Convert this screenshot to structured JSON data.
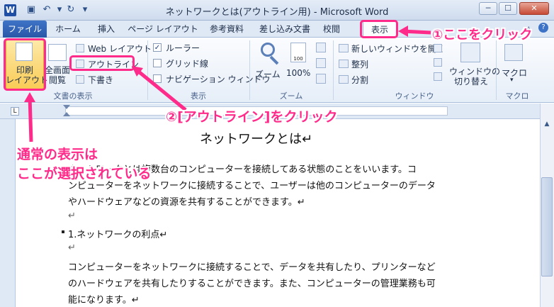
{
  "window": {
    "title": "ネットワークとは(アウトライン用)  -  Microsoft Word",
    "app_icon": "W",
    "buttons": [
      "─",
      "☐",
      "✕"
    ]
  },
  "quick_access": [
    "save-icon",
    "undo-icon",
    "redo-icon",
    "customize-icon"
  ],
  "tabs": [
    "ファイル",
    "ホーム",
    "挿入",
    "ページ レイアウト",
    "参考資料",
    "差し込み文書",
    "校閲",
    "表示"
  ],
  "ribbon": {
    "views": {
      "print_layout": "印刷\nレイアウト",
      "full_screen": "全画面\n閲覧",
      "web_layout": "Web レイアウト",
      "outline": "アウトライン",
      "draft": "下書き",
      "group_label": "文書の表示"
    },
    "show": {
      "ruler": "ルーラー",
      "ruler_checked": true,
      "gridlines": "グリッド線",
      "nav_pane": "ナビゲーション ウィンドウ",
      "group_label": "表示"
    },
    "zoom": {
      "zoom": "ズーム",
      "hundred": "100%",
      "group_label": "ズーム"
    },
    "window": {
      "new_window": "新しいウィンドウを開く",
      "arrange": "整列",
      "split": "分割",
      "switch": "ウィンドウの\n切り替え",
      "group_label": "ウィンドウ"
    },
    "macros": {
      "macro": "マクロ",
      "group_label": "マクロ"
    }
  },
  "document": {
    "heading": "ネットワークとは↵",
    "para1_line1": "ネットワークとは複数台のコンピューターを接続してある状態のことをいいます。コ",
    "para1_line2": "ンピューターをネットワークに接続することで、ユーザーは他のコンピューターのデータ",
    "para1_line3": "やハードウェアなどの資源を共有することができます。↵",
    "blank_mark": "↵",
    "list_item": "1.ネットワークの利点↵",
    "blank2": "↵",
    "para2_line1": "コンピューターをネットワークに接続することで、データを共有したり、プリンターなど",
    "para2_line2": "のハードウェアを共有したりすることができます。また、コンピューターの管理業務も可",
    "para2_line3": "能になります。↵"
  },
  "annotations": {
    "step1": "①ここをクリック",
    "step2": "②[アウトライン]をクリック",
    "normal_line1": "通常の表示は",
    "normal_line2": "ここが選択されている",
    "accent_color": "#ff2b8a"
  }
}
